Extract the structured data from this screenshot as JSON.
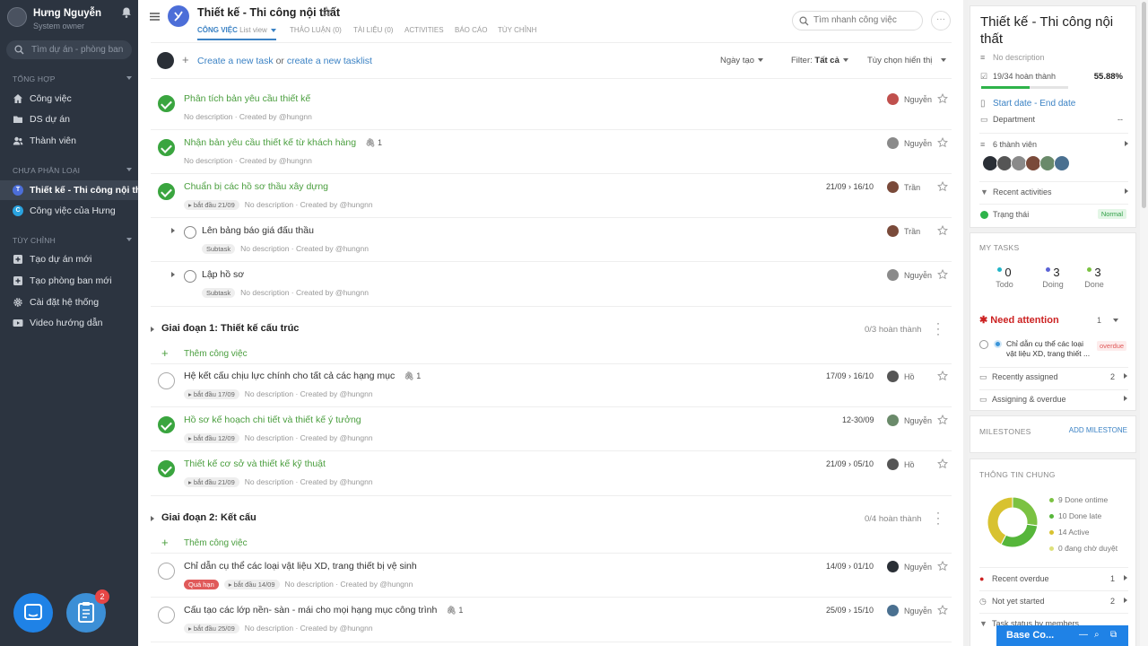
{
  "user": {
    "name": "Hưng Nguyễn",
    "role": "System owner"
  },
  "sidebar": {
    "search_placeholder": "Tìm dự án - phòng ban",
    "sections": [
      "TỔNG HỢP",
      "CHƯA PHÂN LOẠI",
      "TÙY CHỈNH"
    ],
    "general": [
      {
        "label": "Công việc",
        "icon": "home-icon"
      },
      {
        "label": "DS dự án",
        "icon": "folder-icon"
      },
      {
        "label": "Thành viên",
        "icon": "users-icon"
      }
    ],
    "projects": [
      {
        "label": "Thiết kế - Thi công nội th...",
        "letter": "T",
        "color": "#4c6ed8",
        "active": true
      },
      {
        "label": "Công việc của Hưng",
        "letter": "C",
        "color": "#2aa3e0",
        "active": false
      }
    ],
    "custom": [
      {
        "label": "Tạo dự án mới",
        "icon": "plus-square-icon"
      },
      {
        "label": "Tạo phòng ban mới",
        "icon": "plus-square-icon"
      },
      {
        "label": "Cài đặt hệ thống",
        "icon": "gear-icon"
      },
      {
        "label": "Video hướng dẫn",
        "icon": "video-icon"
      }
    ],
    "badge_count": "2"
  },
  "header": {
    "title": "Thiết kế - Thi công nội thất",
    "tabs": {
      "congviec": "CÔNG VIỆC",
      "listview": "List view",
      "thaoluan": "THẢO LUẬN (0)",
      "tailieu": "TÀI LIỆU (0)",
      "activities": "ACTIVITIES",
      "baocao": "BÁO CÁO",
      "tuychinh": "TÙY CHỈNH"
    },
    "search_placeholder": "Tìm nhanh công việc",
    "more": "···"
  },
  "toolbar": {
    "create_task": "Create a new task",
    "or": "or",
    "create_tasklist": "create a new tasklist",
    "sort": "Ngày tạo",
    "filter_label": "Filter:",
    "filter_value": "Tất cả",
    "display_options": "Tùy chọn hiển thị"
  },
  "tasks_top": [
    {
      "name": "Phân tích bản yêu cầu thiết kế",
      "done": true,
      "desc": "No description · Created by @hungnn",
      "user": "Nguyễn",
      "date": "",
      "chip": "",
      "attach": ""
    },
    {
      "name": "Nhận bản yêu cầu thiết kế từ khách hàng",
      "done": true,
      "desc": "No description · Created by @hungnn",
      "user": "Nguyễn",
      "date": "",
      "chip": "",
      "attach": "1"
    },
    {
      "name": "Chuẩn bị các hồ sơ thầu xây dựng",
      "done": true,
      "desc": "No description · Created by @hungnn",
      "user": "Trần",
      "date": "21/09 › 16/10",
      "chip": "bắt đầu 21/09",
      "attach": ""
    }
  ],
  "subtasks": [
    {
      "name": "Lên bảng báo giá đấu thầu",
      "chip": "Subtask",
      "desc": "No description · Created by @hungnn",
      "user": "Trần"
    },
    {
      "name": "Lập hồ sơ",
      "chip": "Subtask",
      "desc": "No description · Created by @hungnn",
      "user": "Nguyễn"
    }
  ],
  "groups": [
    {
      "name": "Giai đoạn 1: Thiết kế cấu trúc",
      "count": "0/3 hoàn thành",
      "add_label": "Thêm công việc",
      "tasks": [
        {
          "name": "Hệ kết cấu chịu lực chính cho tất cả các hạng mục",
          "done": false,
          "chip": "bắt đầu 17/09",
          "desc": "No description · Created by @hungnn",
          "date": "17/09 › 16/10",
          "user": "Hồ",
          "attach": "1"
        },
        {
          "name": "Hồ sơ kế hoạch chi tiết và thiết kế ý tưởng",
          "done": true,
          "chip": "bắt đầu 12/09",
          "desc": "No description · Created by @hungnn",
          "date": "12-30/09",
          "user": "Nguyễn",
          "attach": ""
        },
        {
          "name": "Thiết kế cơ sở và thiết kế kỹ thuật",
          "done": true,
          "chip": "bắt đầu 21/09",
          "desc": "No description · Created by @hungnn",
          "date": "21/09 › 05/10",
          "user": "Hồ",
          "attach": ""
        }
      ]
    },
    {
      "name": "Giai đoạn 2: Kết cấu",
      "count": "0/4 hoàn thành",
      "add_label": "Thêm công việc",
      "tasks": [
        {
          "name": "Chỉ dẫn cụ thể các loại vật liệu XD, trang thiết bị vệ sinh",
          "done": false,
          "late": "Quá hạn",
          "chip": "bắt đầu 14/09",
          "desc": "No description · Created by @hungnn",
          "date": "14/09 › 01/10",
          "user": "Nguyễn",
          "attach": ""
        },
        {
          "name": "Cấu tạo các lớp nền- sàn - mái cho mọi hạng mục công trình",
          "done": false,
          "chip": "bắt đầu 25/09",
          "desc": "No description · Created by @hungnn",
          "date": "25/09 › 15/10",
          "user": "Nguyễn",
          "attach": "1"
        }
      ]
    }
  ],
  "right": {
    "title": "Thiết kế - Thi công nội thất",
    "no_desc": "No description",
    "progress_text": "19/34 hoàn thành",
    "progress_pct": "55.88%",
    "progress_value": 55.88,
    "dates": "Start date - End date",
    "department": "Department",
    "department_value": "--",
    "members": "6 thành viên",
    "recent_activities": "Recent activities",
    "status_label": "Trạng thái",
    "status_value": "Normal",
    "my_tasks": "MY TASKS",
    "todo": {
      "n": "0",
      "l": "Todo",
      "color": "#22b5c8"
    },
    "doing": {
      "n": "3",
      "l": "Doing",
      "color": "#5b63d6"
    },
    "done": {
      "n": "3",
      "l": "Done",
      "color": "#7bc242"
    },
    "need_attention": "Need attention",
    "need_attention_count": "1",
    "attention_task": "Chỉ dẫn cụ thể các loại vật liệu XD, trang thiết ...",
    "attention_tag": "overdue",
    "recently_assigned": "Recently assigned",
    "recently_assigned_count": "2",
    "assigning_overdue": "Assigning & overdue",
    "milestones": "MILESTONES",
    "add_milestone": "ADD MILESTONE",
    "info": "THÔNG TIN CHUNG",
    "legend": [
      {
        "label": "9 Done ontime",
        "color": "#7bc242"
      },
      {
        "label": "10 Done late",
        "color": "#56b63a"
      },
      {
        "label": "14 Active",
        "color": "#d8c230"
      },
      {
        "label": "0 đang chờ duyệt",
        "color": "#dde07a"
      }
    ],
    "recent_overdue": "Recent overdue",
    "recent_overdue_count": "1",
    "not_started": "Not yet started",
    "not_started_count": "2",
    "status_by_members": "Task status by members"
  },
  "chat_bar": "Base Co..."
}
